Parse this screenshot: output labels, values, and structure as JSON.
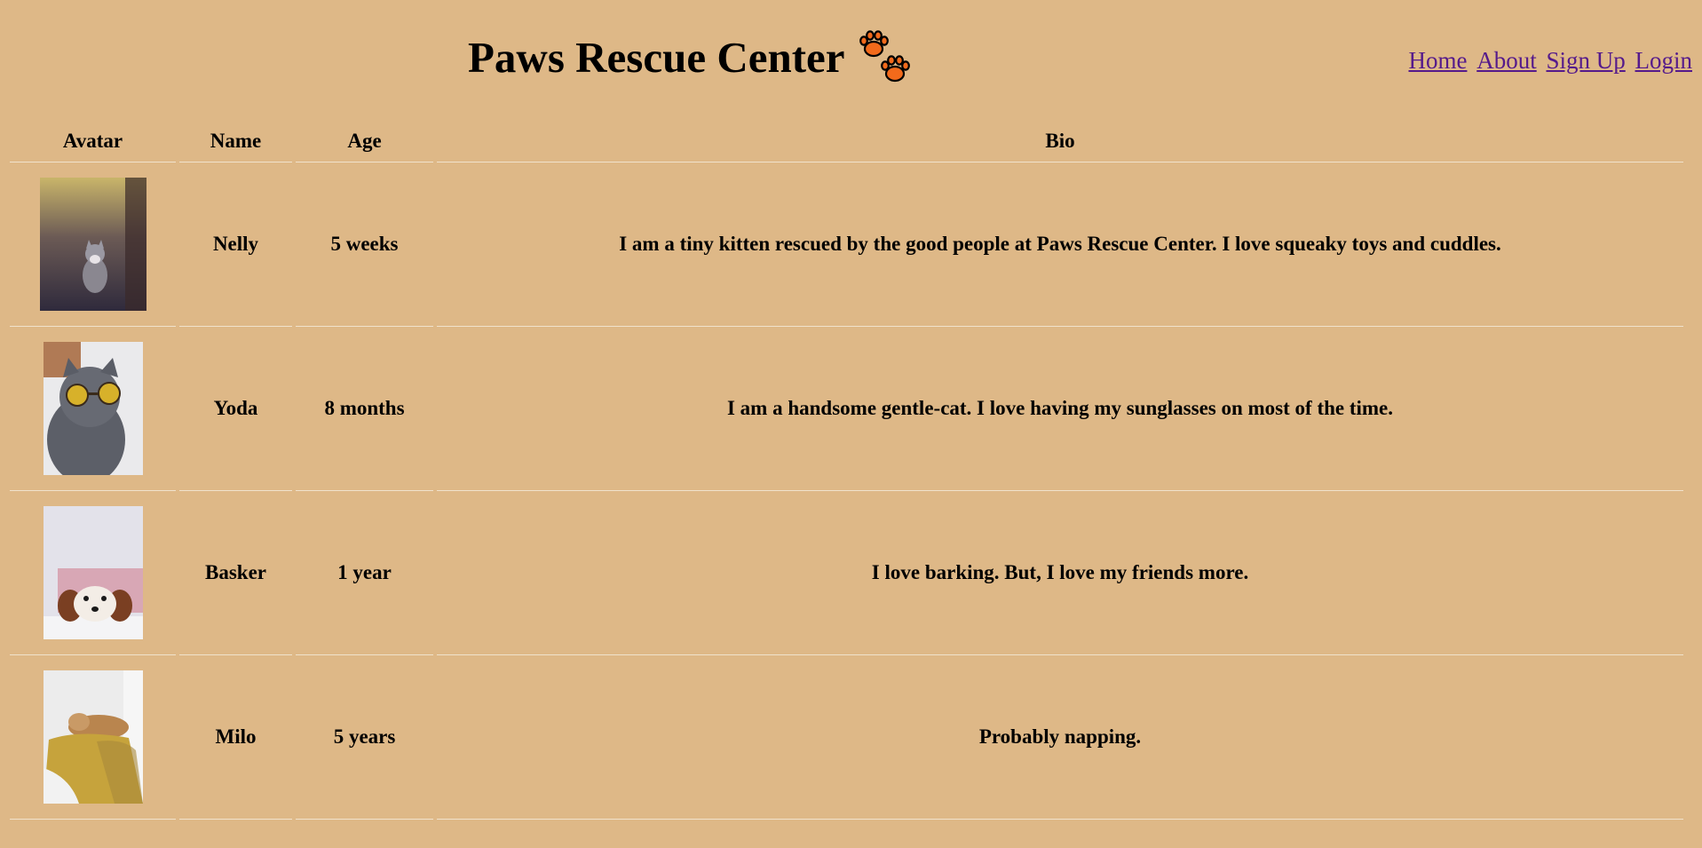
{
  "header": {
    "title": "Paws Rescue Center",
    "logo_icon": "paw-prints-icon",
    "logo_color": "#f26a1b"
  },
  "nav": {
    "items": [
      "Home",
      "About",
      "Sign Up",
      "Login"
    ],
    "link_color": "#551a8b"
  },
  "colors": {
    "background": "#deb887",
    "row_divider": "#f0e2cc"
  },
  "table": {
    "columns": [
      "Avatar",
      "Name",
      "Age",
      "Bio"
    ],
    "rows": [
      {
        "name": "Nelly",
        "age": "5 weeks",
        "bio": "I am a tiny kitten rescued by the good people at Paws Rescue Center. I love squeaky toys and cuddles.",
        "avatar": "kitten-photo"
      },
      {
        "name": "Yoda",
        "age": "8 months",
        "bio": "I am a handsome gentle-cat. I love having my sunglasses on most of the time.",
        "avatar": "cat-with-sunglasses-photo"
      },
      {
        "name": "Basker",
        "age": "1 year",
        "bio": "I love barking. But, I love my friends more.",
        "avatar": "puppy-photo"
      },
      {
        "name": "Milo",
        "age": "5 years",
        "bio": "Probably napping.",
        "avatar": "sleeping-dog-photo"
      }
    ]
  }
}
